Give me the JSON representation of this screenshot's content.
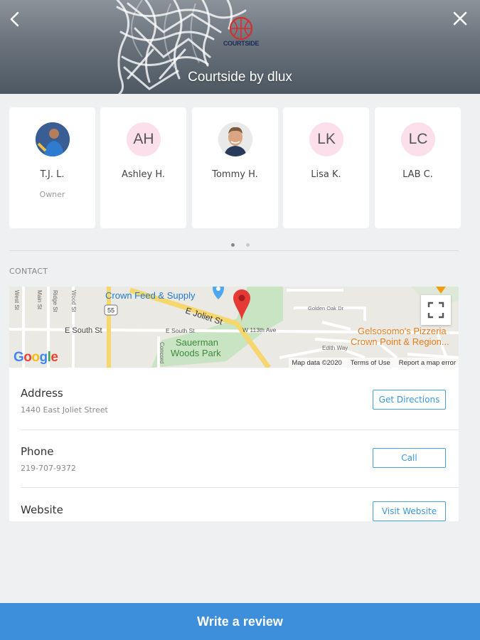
{
  "header": {
    "title": "Courtside by dlux",
    "logo_text": "COURTSIDE",
    "back_icon": "chevron-left-icon",
    "close_icon": "close-icon"
  },
  "staff": [
    {
      "name": "T.J. L.",
      "role": "Owner",
      "initials": "",
      "photo": true
    },
    {
      "name": "Ashley H.",
      "role": "",
      "initials": "AH",
      "photo": false
    },
    {
      "name": "Tommy H.",
      "role": "",
      "initials": "",
      "photo": true
    },
    {
      "name": "Lisa K.",
      "role": "",
      "initials": "LK",
      "photo": false
    },
    {
      "name": "LAB C.",
      "role": "",
      "initials": "LC",
      "photo": false
    }
  ],
  "pager": {
    "pages": 2,
    "active": 0
  },
  "contact": {
    "section_label": "CONTACT",
    "map": {
      "places": {
        "crown_feed": "Crown Feed & Supply",
        "joliet": "E Joliet St",
        "south_st_1": "E South St",
        "south_st_2": "E South St",
        "w113": "W 113th Ave",
        "sauerman_1": "Sauerman",
        "sauerman_2": "Woods Park",
        "gelsosomo_1": "Gelsosomo's Pizzeria",
        "gelsosomo_2": "Crown Point & Region...",
        "golden_oak": "Golden Oak Dr",
        "edith": "Edith Way",
        "concord": "Concord",
        "hwy": "55",
        "road_a": "West St",
        "road_b": "Main St",
        "road_c": "Ridge St",
        "road_d": "Wood St"
      },
      "google": "Google",
      "footer": {
        "data": "Map data ©2020",
        "terms": "Terms of Use",
        "report": "Report a map error"
      }
    },
    "address": {
      "label": "Address",
      "value": "1440 East Joliet Street",
      "button": "Get Directions"
    },
    "phone": {
      "label": "Phone",
      "value": "219-707-9372",
      "button": "Call"
    },
    "website": {
      "label": "Website",
      "button": "Visit Website"
    }
  },
  "review_button": "Write a review",
  "colors": {
    "accent": "#3d8fdc",
    "button_border": "#45a0dc",
    "avatar_bg": "#fbe0ec",
    "map_pin": "#e53935"
  }
}
